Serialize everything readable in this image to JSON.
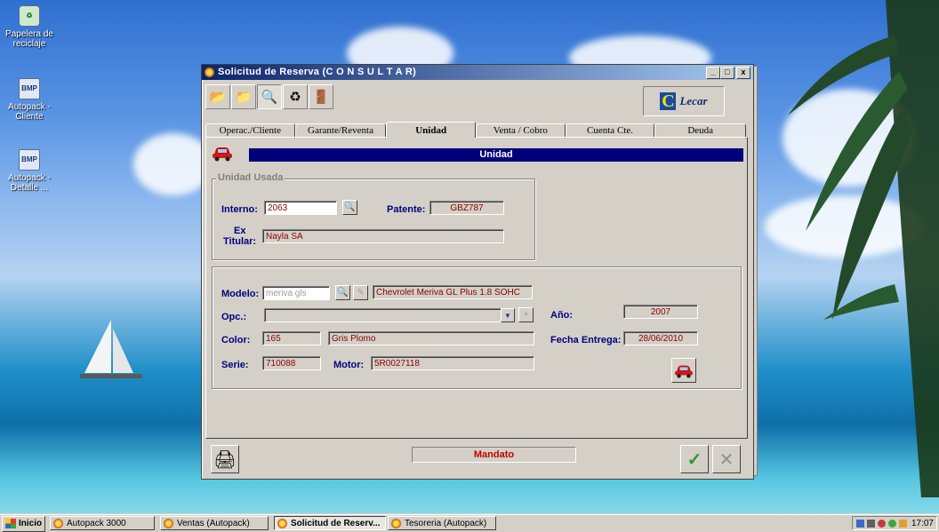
{
  "desktop": {
    "icons": [
      {
        "label": "Papelera de reciclaje",
        "icon": "recycle-bin-icon"
      },
      {
        "label": "Autopack - Cliente",
        "icon": "bmp-file-icon"
      },
      {
        "label": "Autopack - Detalle ...",
        "icon": "bmp-file-icon"
      }
    ]
  },
  "window": {
    "title": "Solicitud de Reserva (C O N S U L T A R)",
    "controls": {
      "minimize": "_",
      "maximize": "□",
      "close": "x"
    },
    "toolbar": [
      {
        "name": "new-icon",
        "glyph": "📂"
      },
      {
        "name": "open-icon",
        "glyph": "📁"
      },
      {
        "name": "search-icon",
        "glyph": "🔍"
      },
      {
        "name": "recycle-icon",
        "glyph": "♻"
      },
      {
        "name": "exit-icon",
        "glyph": "🚪"
      }
    ],
    "logo": {
      "mark": "C",
      "text": "Lecar"
    },
    "tabs": [
      "Operac./Cliente",
      "Garante/Reventa",
      "Unidad",
      "Venta / Cobro",
      "Cuenta Cte.",
      "Deuda"
    ],
    "selected_tab": "Unidad"
  },
  "unidad": {
    "header": "Unidad",
    "usada": {
      "title": "Unidad Usada",
      "interno_label": "Interno:",
      "interno_value": "2063",
      "patente_label": "Patente:",
      "patente_value": "GBZ787",
      "ex_titular_label_1": "Ex",
      "ex_titular_label_2": "Titular:",
      "ex_titular_value": "Nayla SA"
    },
    "detalle": {
      "modelo_label": "Modelo:",
      "modelo_code": "meriva gls",
      "modelo_desc": "Chevrolet Meriva GL Plus 1.8 SOHC",
      "opc_label": "Opc.:",
      "opc_value": "",
      "anio_label": "Año:",
      "anio_value": "2007",
      "color_label": "Color:",
      "color_code": "165",
      "color_desc": "Gris Plomo",
      "fecha_label": "Fecha Entrega:",
      "fecha_value": "28/06/2010",
      "serie_label": "Serie:",
      "serie_value": "710088",
      "motor_label": "Motor:",
      "motor_value": "5R0027118"
    }
  },
  "footer": {
    "status": "Mandato",
    "ok_glyph": "✓",
    "cancel_glyph": "✕"
  },
  "taskbar": {
    "start": "Inicio",
    "items": [
      {
        "label": "Autopack 3000",
        "active": false
      },
      {
        "label": "Ventas (Autopack)",
        "active": false
      },
      {
        "label": "Solicitud de Reserv...",
        "active": true
      },
      {
        "label": "Tesoreria (Autopack)",
        "active": false
      }
    ],
    "clock": "17:07"
  },
  "colors": {
    "header_bar": "#00007a",
    "label": "#000080",
    "value": "#8b0000",
    "status": "#c00000"
  }
}
